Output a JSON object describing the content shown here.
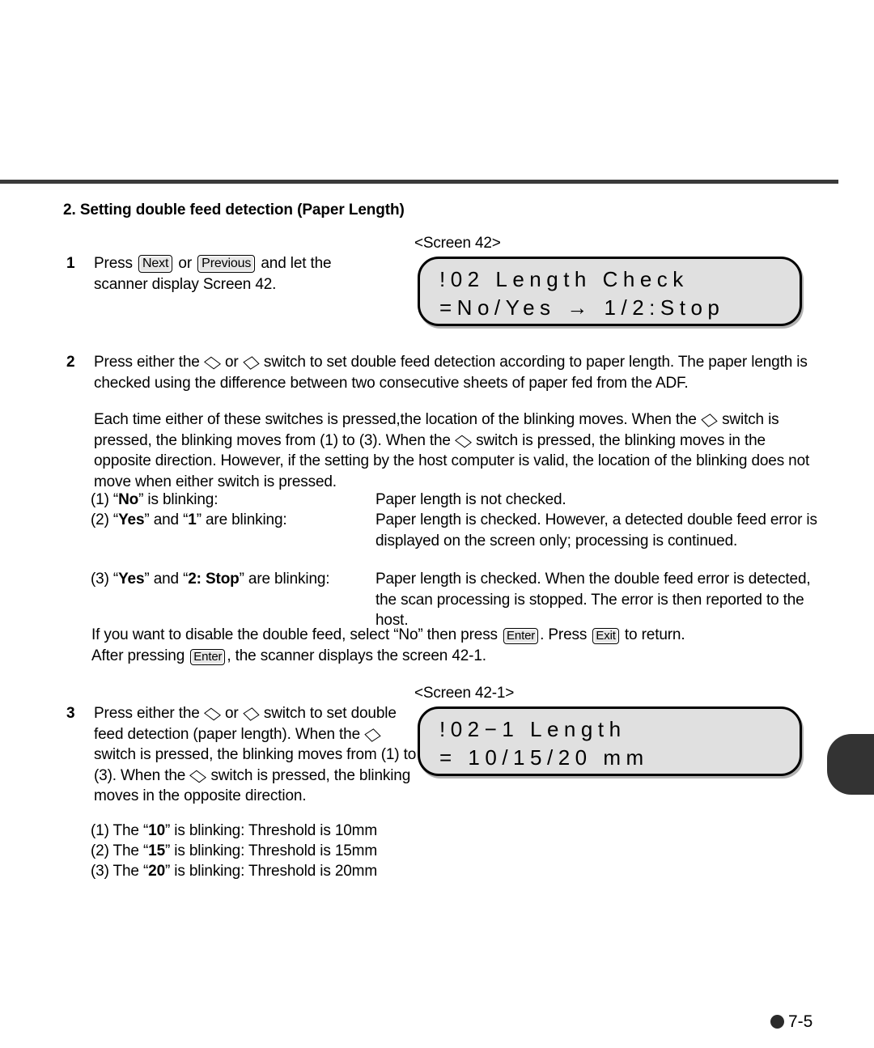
{
  "page": {
    "footer_page_number": "7-5",
    "footer_bullet": "filled-circle"
  },
  "heading": "2. Setting double feed detection (Paper Length)",
  "steps": {
    "step1": {
      "number": "1",
      "text_before_key1": "Press",
      "key1": "Next",
      "text_between_keys": "or",
      "key2": "Previous",
      "text_after_keys": "and let the",
      "line2": "scanner display Screen 42."
    },
    "step2": {
      "number": "2",
      "line1_a": "Press either the",
      "line1_b": "or",
      "line1_c": "switch to set double feed detection according to paper length.  The paper",
      "line2": "length is checked using the difference between two consecutive sheets of paper fed from the ADF."
    },
    "step3": {
      "number": "3",
      "l1_a": "Press either the",
      "l1_b": "or",
      "l1_c": "switch to set",
      "l2": "double feed detection (paper length).",
      "l3_a": "When the",
      "l3_b": "switch is pressed, the",
      "l4": "blinking moves from (1) to (3). When the",
      "l5": "switch is pressed, the  blinking moves",
      "l6": "in the opposite direction."
    }
  },
  "paragraph_blinking": {
    "l1_a": "Each time either of these switches is pressed,the location of the blinking moves. When the",
    "l2_a": "switch is pressed, the blinking moves from (1) to (3). When the",
    "l2_b": "switch is pressed, the  blinking",
    "l3": "moves in the opposite direction. However, if the setting by the host computer is valid, the location",
    "l4": "of the blinking does not move when either switch is pressed."
  },
  "blink_states": [
    {
      "label_prefix": "(1) “",
      "label_bold": "No",
      "label_suffix": "” is blinking:",
      "description": "Paper length is not checked."
    },
    {
      "label_prefix": "(2) “",
      "label_bold": "Yes",
      "label_mid": "” and “",
      "label_bold2": "1",
      "label_suffix": "” are blinking:",
      "description": "Paper length is checked.  However, a detected double feed error is displayed on the screen only; processing is continued."
    },
    {
      "label_prefix": "(3) “",
      "label_bold": "Yes",
      "label_mid": "” and “",
      "label_bold2": "2: Stop",
      "label_suffix": "” are blinking:",
      "description": "Paper length is checked.  When the double feed error is detected, the scan processing is stopped.  The error is then reported to the host."
    }
  ],
  "disable_note": {
    "l1_a": "If you want to disable the double feed, select “No” then press",
    "l1_key1": "Enter",
    "l1_b": ". Press",
    "l1_key2": "Exit",
    "l1_c": "to return.",
    "l2_a": "After pressing",
    "l2_key": "Enter",
    "l2_b": ", the scanner displays the screen 42-1."
  },
  "thresholds": [
    {
      "prefix": "(1) The “",
      "bold": "10",
      "suffix": "” is blinking: Threshold is 10mm"
    },
    {
      "prefix": "(2) The “",
      "bold": "15",
      "suffix": "” is blinking: Threshold is 15mm"
    },
    {
      "prefix": "(3) The “",
      "bold": "20",
      "suffix": "” is blinking: Threshold is 20mm"
    }
  ],
  "screens": [
    {
      "caption": "<Screen 42>",
      "line1": "!02 Length Check",
      "line2": "=No/Yes → 1/2:Stop"
    },
    {
      "caption": "<Screen 42-1>",
      "line1": "!02−1 Length",
      "line2": "= 10/15/20 mm"
    }
  ]
}
